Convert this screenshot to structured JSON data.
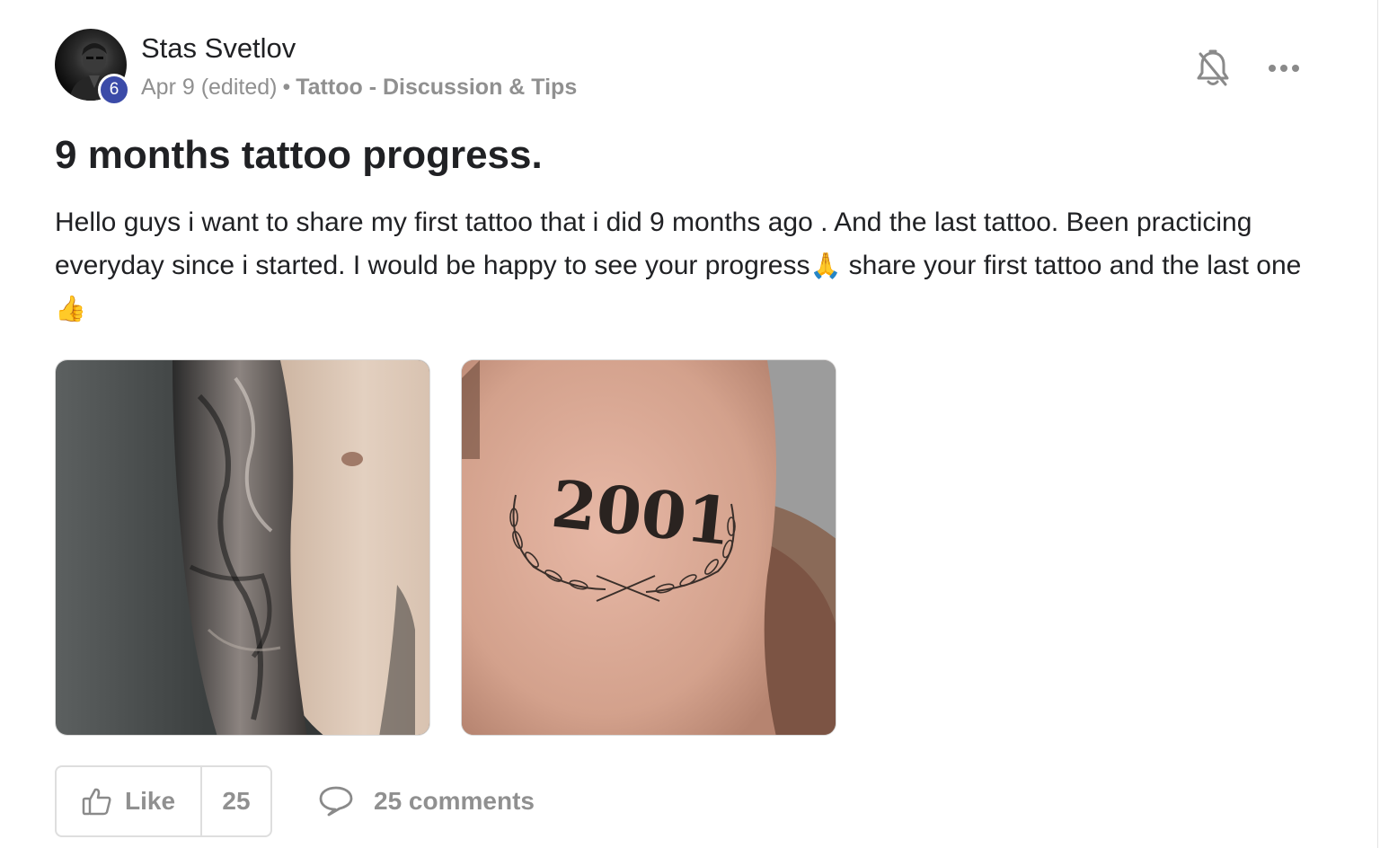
{
  "post": {
    "author": {
      "name": "Stas Svetlov",
      "level": "6",
      "avatar_icon": "avatar-photo"
    },
    "meta": {
      "date": "Apr 9 (edited)",
      "separator": "•",
      "category": "Tattoo - Discussion & Tips"
    },
    "actions_top": {
      "notify_icon": "bell-off-icon",
      "more_icon": "more-horizontal-icon"
    },
    "title": "9 months tattoo progress.",
    "body": {
      "text_1": "Hello guys i want to share my first tattoo that i did 9 months ago . And the last tattoo. Been practicing everyday since i started. I would be happy to see your progress",
      "emoji_1": "🙏",
      "text_2": " share your first tattoo and the last one",
      "emoji_2": "👍"
    },
    "images": [
      {
        "name": "tattoo-photo-sleeve"
      },
      {
        "name": "tattoo-photo-2001",
        "tattoo_text": "2001"
      }
    ],
    "footer": {
      "like_label": "Like",
      "like_count": "25",
      "comments_label": "25 comments",
      "like_icon": "thumbs-up-icon",
      "comment_icon": "comment-icon"
    }
  },
  "colors": {
    "badge": "#3b4ba8",
    "muted_text": "#909090",
    "text": "#202124",
    "border": "#dedede"
  }
}
